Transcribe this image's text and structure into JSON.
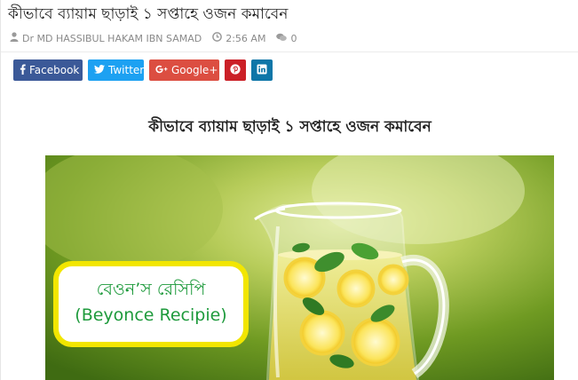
{
  "post": {
    "title": "কীভাবে ব্যায়াম ছাড়াই ১ সপ্তাহে ওজন কমাবেন",
    "author": "Dr MD HASSIBUL HAKAM IBN SAMAD",
    "time": "2:56 AM",
    "comments": "0"
  },
  "share": {
    "facebook": "Facebook",
    "twitter": "Twitter",
    "google": "Google+"
  },
  "article": {
    "heading": "কীভাবে ব্যায়াম ছাড়াই ১ সপ্তাহে ওজন কমাবেন"
  },
  "image": {
    "label_line1": "বেওন’স রেসিপি",
    "label_line2": "(Beyonce Recipie)"
  },
  "colors": {
    "facebook": "#3b5998",
    "twitter": "#1da1f2",
    "google": "#dc4e41",
    "pinterest": "#cb2027",
    "linkedin": "#0e76a8",
    "label_text": "#1e9a3c",
    "label_border": "#f2e600"
  }
}
